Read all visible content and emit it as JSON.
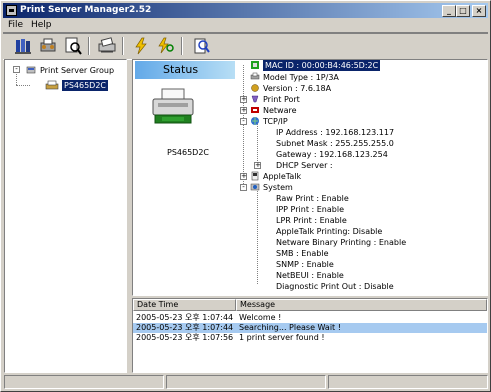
{
  "window": {
    "title": "Print Server Manager2.52",
    "controls": {
      "minimize": "_",
      "maximize": "□",
      "close": "×"
    }
  },
  "menu": [
    {
      "label": "File"
    },
    {
      "label": "Help"
    }
  ],
  "toolbar": {
    "buttons": [
      {
        "icon": "books-icon"
      },
      {
        "icon": "settings-printer-icon"
      },
      {
        "icon": "search-document-icon"
      },
      {
        "icon": "printer-setup-icon"
      },
      {
        "icon": "lightning-icon"
      },
      {
        "icon": "lightning-search-icon"
      },
      {
        "icon": "help-icon"
      }
    ]
  },
  "left_tree": {
    "root": {
      "label": "Print Server Group",
      "expander": "-"
    },
    "child": {
      "label": "PS465D2C"
    }
  },
  "status_panel": {
    "banner": "Status",
    "printer_name": "PS465D2C"
  },
  "detail_tree": {
    "mac": "MAC ID : 00:00:B4:46:5D:2C",
    "model": "Model Type : 1P/3A",
    "version": "Version : 7.6.18A",
    "print_port": {
      "label": "Print Port",
      "expander": "+"
    },
    "netware": {
      "label": "Netware",
      "expander": "+"
    },
    "tcpip": {
      "label": "TCP/IP",
      "expander": "-",
      "ip": "IP Address : 192.168.123.117",
      "subnet": "Subnet Mask : 255.255.255.0",
      "gateway": "Gateway : 192.168.123.254",
      "dhcp": {
        "label": "DHCP Server :",
        "expander": "+"
      }
    },
    "appletalk": {
      "label": "AppleTalk",
      "expander": "+"
    },
    "system": {
      "label": "System",
      "expander": "-",
      "items": [
        "Raw Print : Enable",
        "IPP Print : Enable",
        "LPR Print : Enable",
        "AppleTalk Printing: Disable",
        "Netware Binary Printing : Enable",
        "SMB : Enable",
        "SNMP : Enable",
        "NetBEUI : Enable",
        "Diagnostic Print Out : Disable"
      ]
    }
  },
  "log": {
    "columns": [
      "Date Time",
      "Message"
    ],
    "rows": [
      {
        "time": "2005-05-23 오후 1:07:44",
        "message": "Welcome !"
      },
      {
        "time": "2005-05-23 오후 1:07:44",
        "message": "Searching... Please Wait !"
      },
      {
        "time": "2005-05-23 오후 1:07:56",
        "message": "1 print server found !"
      }
    ]
  }
}
